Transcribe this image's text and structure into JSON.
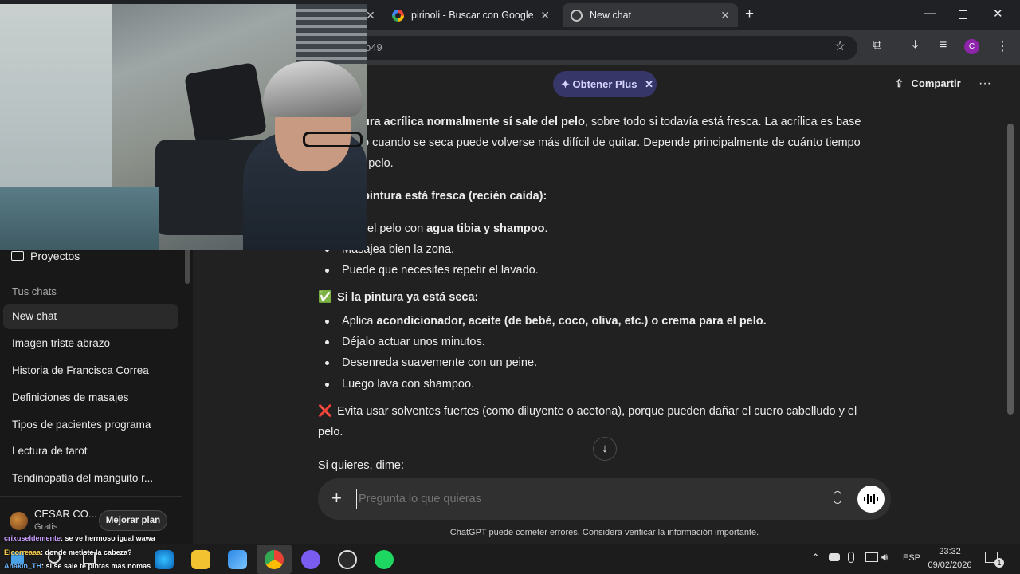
{
  "browser": {
    "tabs": [
      {
        "title": "pirinoli - Buscar con Google",
        "icon": "google-icon"
      },
      {
        "title": "New chat",
        "icon": "chatgpt-icon",
        "active": true
      }
    ],
    "url_fragment": "b49",
    "profile_initial": "C"
  },
  "header": {
    "plus_label": "Obtener Plus",
    "share_label": "Compartir"
  },
  "sidebar": {
    "projects_label": "Proyectos",
    "section_label": "Tus chats",
    "chats": [
      "New chat",
      "Imagen triste abrazo",
      "Historia de Francisca Correa",
      "Definiciones de masajes",
      "Tipos de pacientes programa",
      "Lectura de tarot",
      "Tendinopatía del manguito r..."
    ],
    "user_name": "CESAR CO...",
    "user_plan": "Gratis",
    "upgrade_label": "Mejorar plan"
  },
  "message": {
    "p1_bold": "ura acrílica normalmente sí sale del pelo",
    "p1_rest": ", sobre todo si todavía está fresca. La acrílica es base",
    "p1_line2": "o cuando se seca puede volverse más difícil de quitar. Depende principalmente de cuánto tiempo",
    "p1_line3": "l pelo.",
    "h1": "pintura está fresca (recién caída):",
    "fresh_1_pre": "el pelo con ",
    "fresh_1_bold": "agua tibia y shampoo",
    "fresh_1_post": ".",
    "fresh_2": "Masajea bien la zona.",
    "fresh_3": "Puede que necesites repetir el lavado.",
    "h2_icon": "✅",
    "h2": "Si la pintura ya está seca:",
    "dry_1_pre": "Aplica ",
    "dry_1_bold": "acondicionador, aceite (de bebé, coco, oliva, etc.) o crema para el pelo.",
    "dry_2": "Déjalo actuar unos minutos.",
    "dry_3": "Desenreda suavemente con un peine.",
    "dry_4": "Luego lava con shampoo.",
    "warn_icon": "❌",
    "warn_line1": "Evita usar solventes fuertes (como diluyente o acetona), porque pueden dañar el cuero cabelludo y el",
    "warn_line2": "pelo.",
    "closing": "Si quieres, dime:"
  },
  "composer": {
    "placeholder": "Pregunta lo que quieras"
  },
  "disclaimer": "ChatGPT puede cometer errores. Considera verificar la información importante.",
  "stream_chat": [
    {
      "user": "crixuseldemente",
      "text": ": se ve hermoso igual wawa"
    },
    {
      "user": "Elcorreaaa",
      "text": ": donde metiste la cabeza?"
    },
    {
      "user": "Anakin_TH",
      "text": ": si se sale te pintas más nomas"
    }
  ],
  "taskbar": {
    "lang": "ESP",
    "time": "23:32",
    "date": "09/02/2026",
    "notif_count": "1"
  },
  "colors": {
    "accent_plus": "#373669",
    "sidebar_bg": "#181818",
    "main_bg": "#212121"
  }
}
